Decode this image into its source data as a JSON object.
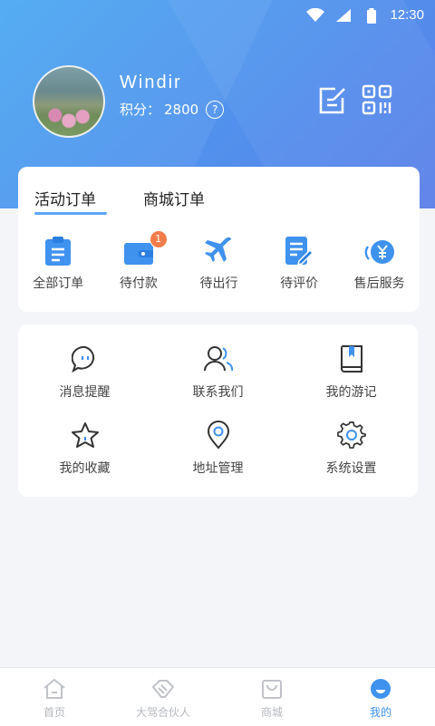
{
  "status_bar": {
    "time": "12:30"
  },
  "profile": {
    "username": "Windir",
    "points_label": "积分：",
    "points_value": "2800",
    "help_mark": "?"
  },
  "orders": {
    "tabs": [
      {
        "label": "活动订单"
      },
      {
        "label": "商城订单"
      }
    ],
    "items": [
      {
        "label": "全部订单",
        "icon": "clipboard-icon"
      },
      {
        "label": "待付款",
        "icon": "wallet-icon",
        "badge": "1"
      },
      {
        "label": "待出行",
        "icon": "airplane-icon"
      },
      {
        "label": "待评价",
        "icon": "review-icon"
      },
      {
        "label": "售后服务",
        "icon": "yuan-service-icon"
      }
    ]
  },
  "menu": {
    "items": [
      {
        "label": "消息提醒",
        "icon": "message-icon"
      },
      {
        "label": "联系我们",
        "icon": "contacts-icon"
      },
      {
        "label": "我的游记",
        "icon": "journal-icon"
      },
      {
        "label": "我的收藏",
        "icon": "star-icon"
      },
      {
        "label": "地址管理",
        "icon": "location-icon"
      },
      {
        "label": "系统设置",
        "icon": "gear-icon"
      }
    ]
  },
  "tabbar": {
    "items": [
      {
        "label": "首页",
        "icon": "home-icon"
      },
      {
        "label": "大驾合伙人",
        "icon": "handshake-icon"
      },
      {
        "label": "商城",
        "icon": "shopping-bag-icon"
      },
      {
        "label": "我的",
        "icon": "user-icon",
        "active": true
      }
    ]
  },
  "colors": {
    "accent": "#3f92ee",
    "badge": "#f27c4a",
    "header_start": "#4aa8f2",
    "header_end": "#5b7fe8"
  }
}
